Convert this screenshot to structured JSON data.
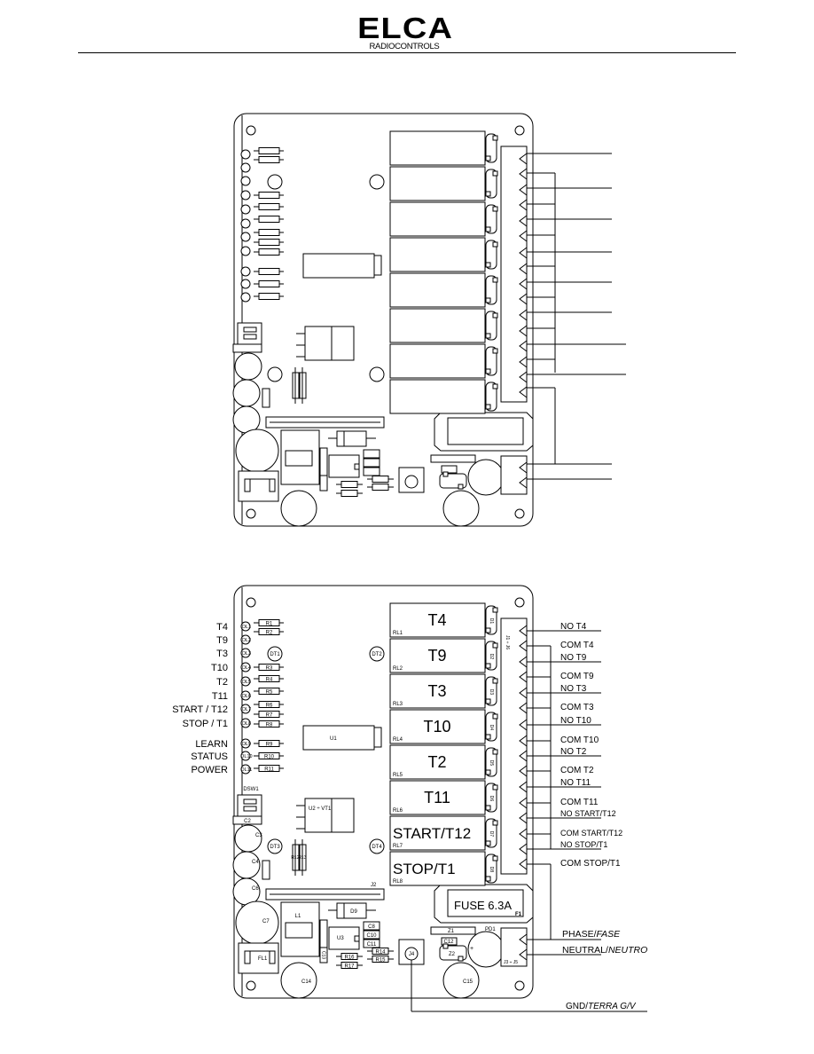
{
  "header": {
    "logo_text": "ELCA",
    "logo_subtext": "RADIOCONTROLS"
  },
  "relays": [
    {
      "id": "RL1",
      "label": "T4",
      "diode": "D1"
    },
    {
      "id": "RL2",
      "label": "T9",
      "diode": "D2"
    },
    {
      "id": "RL3",
      "label": "T3",
      "diode": "D3"
    },
    {
      "id": "RL4",
      "label": "T10",
      "diode": "D4"
    },
    {
      "id": "RL5",
      "label": "T2",
      "diode": "D5"
    },
    {
      "id": "RL6",
      "label": "T11",
      "diode": "D6"
    },
    {
      "id": "RL7",
      "label": "START/T12",
      "diode": "D7"
    },
    {
      "id": "RL8",
      "label": "STOP/T1",
      "diode": "D8"
    }
  ],
  "led_labels": [
    {
      "label": "T4",
      "led": "DL1"
    },
    {
      "label": "T9",
      "led": "DL2"
    },
    {
      "label": "T3",
      "led": "DL3"
    },
    {
      "label": "T10",
      "led": "DL4"
    },
    {
      "label": "T2",
      "led": "DL5"
    },
    {
      "label": "T11",
      "led": "DL6"
    },
    {
      "label": "START / T12",
      "led": "DL7"
    },
    {
      "label": "STOP / T1",
      "led": "DL8"
    },
    {
      "label": "LEARN",
      "led": "DL9"
    },
    {
      "label": "STATUS",
      "led": "DL10"
    },
    {
      "label": "POWER",
      "led": "DL11"
    }
  ],
  "resistors": [
    "R1",
    "R2",
    "R3",
    "R4",
    "R5",
    "R6",
    "R7",
    "R8",
    "R9",
    "R10",
    "R11"
  ],
  "terminal_labels": [
    "NO   T4",
    "COM  T4",
    "NO    T9",
    "COM  T9",
    "NO    T3",
    "COM  T3",
    "NO    T10",
    "COM  T10",
    "NO    T2",
    "COM  T2",
    "NO    T11",
    "COM  T11",
    "NO    START/T12",
    "COM START/T12",
    "NO    STOP/T1",
    "COM STOP/T1"
  ],
  "connector_j1": "J1 ÷ J6",
  "connector_j3": "J3 ÷ J5",
  "power_labels": {
    "phase": "PHASE/",
    "phase_it": "FASE",
    "neutral": "NEUTRAL/",
    "neutral_it": "NEUTRO",
    "gnd": "GND/",
    "gnd_it": "TERRA  G/V"
  },
  "fuse": {
    "label": "FUSE 6.3A",
    "id": "F1"
  },
  "components": {
    "dt1": "DT1",
    "dt2": "DT2",
    "dt3": "DT3",
    "dt4": "DT4",
    "u1": "U1",
    "c1": "C1",
    "dsw1": "DSW1",
    "c2": "C2",
    "u2": "U2 ÷ VT1",
    "c3": "C3",
    "c4": "C4",
    "c5": "C5",
    "c6": "C6",
    "c7": "C7",
    "r12": "R12",
    "r13": "R13",
    "j2": "J2",
    "l1": "L1",
    "d9": "D9",
    "c9": "C9",
    "u3": "U3",
    "c8": "C8",
    "c10": "C10",
    "c11": "C11",
    "c13": "C13",
    "fl1": "FL1",
    "r16": "R16",
    "r17": "R17",
    "r14": "R14",
    "r15": "R15",
    "j4": "J4",
    "c14": "C14",
    "c15": "C15",
    "z1": "Z1",
    "c12": "C12",
    "z2": "Z2",
    "pd1": "PD1"
  }
}
